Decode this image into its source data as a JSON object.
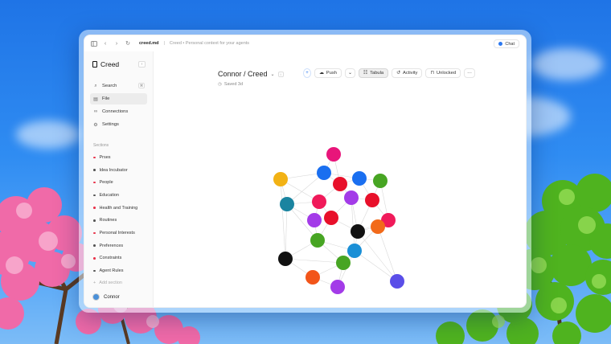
{
  "window": {
    "file_name": "creed.md",
    "separator": "|",
    "description": "Creed • Personal context for your agents",
    "chat_label": "Chat"
  },
  "sidebar": {
    "brand": "Creed",
    "nav": [
      {
        "label": "Search",
        "icon": "search-icon"
      },
      {
        "label": "File",
        "icon": "file-icon",
        "active": true
      },
      {
        "label": "Connections",
        "icon": "link-icon"
      },
      {
        "label": "Settings",
        "icon": "gear-icon"
      }
    ],
    "sections_label": "Sections",
    "sections": [
      {
        "label": "Prses",
        "color": "#e8334a"
      },
      {
        "label": "Idea Incubator",
        "color": "#555555"
      },
      {
        "label": "People",
        "color": "#e8334a"
      },
      {
        "label": "Education",
        "color": "#555555"
      },
      {
        "label": "Health and Training",
        "color": "#e8334a"
      },
      {
        "label": "Routines",
        "color": "#555555"
      },
      {
        "label": "Personal Interests",
        "color": "#e8334a"
      },
      {
        "label": "Preferences",
        "color": "#555555"
      },
      {
        "label": "Constraints",
        "color": "#e8334a"
      },
      {
        "label": "Agent Rules",
        "color": "#555555"
      }
    ],
    "add_section": "Add section",
    "user": "Connor"
  },
  "main": {
    "title": "Connor / Creed",
    "saved": "Saved 3d",
    "toolbar": {
      "push": "Push",
      "tabula": "Tabula",
      "activity": "Activity",
      "unlocked": "Unlocked"
    }
  },
  "graph": {
    "nodes": [
      {
        "id": "n1",
        "color": "#e8157a"
      },
      {
        "id": "n2",
        "color": "#1a6ff0"
      },
      {
        "id": "n3",
        "color": "#f2b215"
      },
      {
        "id": "n4",
        "color": "#e8102a"
      },
      {
        "id": "n5",
        "color": "#1a6ff0"
      },
      {
        "id": "n6",
        "color": "#47a523"
      },
      {
        "id": "n7",
        "color": "#1a84a0"
      },
      {
        "id": "n8",
        "color": "#f01a5a"
      },
      {
        "id": "n9",
        "color": "#a33be8"
      },
      {
        "id": "n10",
        "color": "#e8102a"
      },
      {
        "id": "n11",
        "color": "#a33be8"
      },
      {
        "id": "n12",
        "color": "#e8102a"
      },
      {
        "id": "n13",
        "color": "#f01a5a"
      },
      {
        "id": "n14",
        "color": "#111111"
      },
      {
        "id": "n15",
        "color": "#f26a1a"
      },
      {
        "id": "n16",
        "color": "#47a523"
      },
      {
        "id": "n17",
        "color": "#1a8fd6"
      },
      {
        "id": "n18",
        "color": "#111111"
      },
      {
        "id": "n19",
        "color": "#47a523"
      },
      {
        "id": "n20",
        "color": "#f2551a"
      },
      {
        "id": "n21",
        "color": "#5a4ee8"
      },
      {
        "id": "n22",
        "color": "#a33be8"
      }
    ],
    "edges": [
      [
        "n1",
        "n2"
      ],
      [
        "n1",
        "n4"
      ],
      [
        "n2",
        "n4"
      ],
      [
        "n2",
        "n3"
      ],
      [
        "n2",
        "n7"
      ],
      [
        "n2",
        "n5"
      ],
      [
        "n3",
        "n7"
      ],
      [
        "n3",
        "n8"
      ],
      [
        "n4",
        "n8"
      ],
      [
        "n4",
        "n9"
      ],
      [
        "n4",
        "n5"
      ],
      [
        "n5",
        "n6"
      ],
      [
        "n5",
        "n10"
      ],
      [
        "n6",
        "n10"
      ],
      [
        "n6",
        "n13"
      ],
      [
        "n7",
        "n8"
      ],
      [
        "n7",
        "n11"
      ],
      [
        "n7",
        "n16"
      ],
      [
        "n7",
        "n18"
      ],
      [
        "n8",
        "n12"
      ],
      [
        "n8",
        "n11"
      ],
      [
        "n9",
        "n10"
      ],
      [
        "n9",
        "n12"
      ],
      [
        "n9",
        "n14"
      ],
      [
        "n10",
        "n13"
      ],
      [
        "n10",
        "n14"
      ],
      [
        "n11",
        "n12"
      ],
      [
        "n11",
        "n16"
      ],
      [
        "n12",
        "n14"
      ],
      [
        "n13",
        "n15"
      ],
      [
        "n13",
        "n14"
      ],
      [
        "n14",
        "n15"
      ],
      [
        "n14",
        "n17"
      ],
      [
        "n14",
        "n21"
      ],
      [
        "n15",
        "n17"
      ],
      [
        "n15",
        "n21"
      ],
      [
        "n16",
        "n18"
      ],
      [
        "n16",
        "n19"
      ],
      [
        "n16",
        "n17"
      ],
      [
        "n17",
        "n19"
      ],
      [
        "n17",
        "n21"
      ],
      [
        "n18",
        "n20"
      ],
      [
        "n18",
        "n19"
      ],
      [
        "n19",
        "n20"
      ],
      [
        "n19",
        "n22"
      ],
      [
        "n20",
        "n22"
      ],
      [
        "n22",
        "n17"
      ],
      [
        "n12",
        "n16"
      ],
      [
        "n9",
        "n17"
      ],
      [
        "n3",
        "n18"
      ]
    ]
  }
}
